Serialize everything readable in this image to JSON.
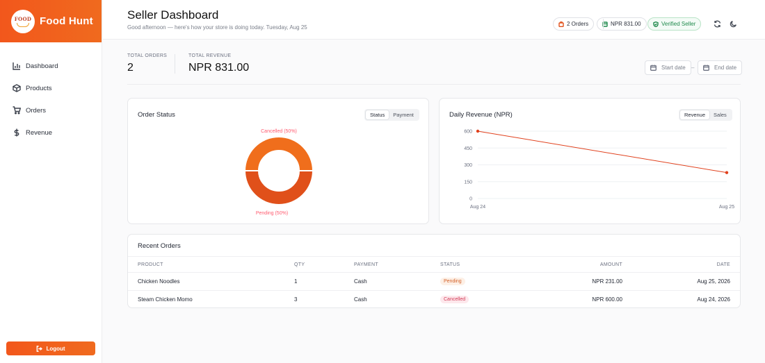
{
  "brand": {
    "name": "Food Hunt",
    "logo_text": "FOOD"
  },
  "sidebar": {
    "items": [
      {
        "label": "Dashboard",
        "icon": "bar-chart-icon"
      },
      {
        "label": "Products",
        "icon": "box-icon"
      },
      {
        "label": "Orders",
        "icon": "cart-icon"
      },
      {
        "label": "Revenue",
        "icon": "dollar-icon"
      }
    ],
    "logout_label": "Logout"
  },
  "header": {
    "title": "Seller Dashboard",
    "greeting": "Good afternoon — here's how your store is doing today. Tuesday, Aug 25",
    "orders_pill": "2 Orders",
    "revenue_pill": "NPR 831.00",
    "verified_pill": "Verified Seller"
  },
  "stats": {
    "orders_label": "TOTAL ORDERS",
    "orders_value": "2",
    "revenue_label": "TOTAL REVENUE",
    "revenue_value": "NPR 831.00"
  },
  "date_filter": {
    "start_placeholder": "Start date",
    "end_placeholder": "End date",
    "separator": "–"
  },
  "order_status_card": {
    "title": "Order Status",
    "tabs": [
      "Status",
      "Payment"
    ],
    "active_tab": "Status"
  },
  "revenue_card": {
    "title": "Daily Revenue (NPR)",
    "tabs": [
      "Revenue",
      "Sales"
    ],
    "active_tab": "Revenue"
  },
  "colors": {
    "accent": "#f2571c",
    "line": "#e0401c",
    "pie_top": "#f06e1c",
    "pie_bottom": "#e0501a",
    "label": "#ff5a6e"
  },
  "chart_data": [
    {
      "type": "pie",
      "donut": true,
      "slices": [
        {
          "label": "Cancelled (50%)",
          "value": 50
        },
        {
          "label": "Pending (50%)",
          "value": 50
        }
      ]
    },
    {
      "type": "line",
      "x": [
        "Aug 24",
        "Aug 25"
      ],
      "series": [
        {
          "values": [
            600,
            231
          ]
        }
      ],
      "yticks": [
        0,
        150,
        300,
        450,
        600
      ],
      "ylim": [
        0,
        600
      ],
      "grid": true
    }
  ],
  "recent_orders": {
    "title": "Recent Orders",
    "columns": [
      "PRODUCT",
      "QTY",
      "PAYMENT",
      "STATUS",
      "AMOUNT",
      "DATE"
    ],
    "rows": [
      {
        "product": "Chicken Noodles",
        "qty": "1",
        "payment": "Cash",
        "status": "Pending",
        "amount": "NPR 231.00",
        "date": "Aug 25, 2026"
      },
      {
        "product": "Steam Chicken Momo",
        "qty": "3",
        "payment": "Cash",
        "status": "Cancelled",
        "amount": "NPR 600.00",
        "date": "Aug 24, 2026"
      }
    ]
  }
}
